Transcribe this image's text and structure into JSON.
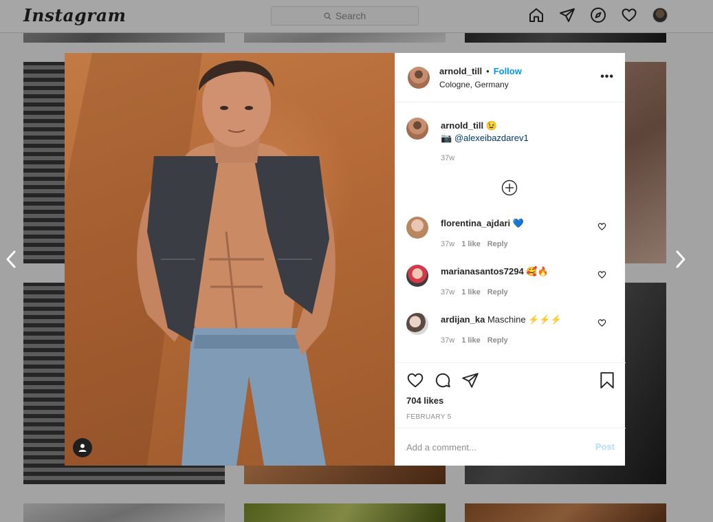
{
  "app": {
    "logo": "Instagram",
    "search_placeholder": "Search",
    "nav_icons": [
      "home-icon",
      "direct-icon",
      "explore-icon",
      "activity-heart-icon",
      "profile-avatar"
    ]
  },
  "post": {
    "username": "arnold_till",
    "follow_label": "Follow",
    "separator": "•",
    "location": "Cologne, Germany",
    "more_label": "•••",
    "caption": {
      "username": "arnold_till",
      "emoji": "😉",
      "camera": "📷",
      "mention": "@alexeibazdarev1",
      "time": "37w"
    },
    "comments": [
      {
        "username": "florentina_ajdari",
        "text": "💙",
        "time": "37w",
        "likes": "1 like",
        "reply": "Reply"
      },
      {
        "username": "marianasantos7294",
        "text": "🥰🔥",
        "time": "37w",
        "likes": "1 like",
        "reply": "Reply"
      },
      {
        "username": "ardijan_ka",
        "text": "Maschine ⚡⚡⚡",
        "time": "37w",
        "likes": "1 like",
        "reply": "Reply"
      }
    ],
    "likes": "704 likes",
    "date": "FEBRUARY 5",
    "add_comment_placeholder": "Add a comment...",
    "post_label": "Post"
  },
  "colors": {
    "accent": "#0095f6",
    "post_disabled": "#b2dffc",
    "photo_background": "#b56a37"
  }
}
